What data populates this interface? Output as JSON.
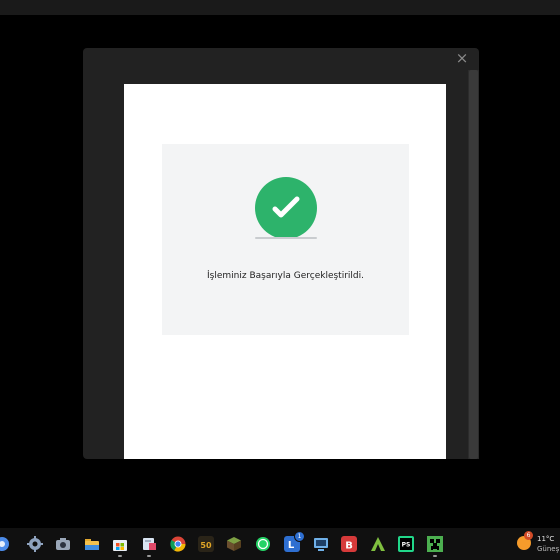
{
  "modal": {
    "close_symbol": "×",
    "success_message": "İşleminiz Başarıyla Gerçekleştirildi.",
    "success_icon": "check-circle-icon",
    "accent_color": "#2db36b"
  },
  "taskbar": {
    "icons": [
      {
        "name": "app-partial-icon",
        "color": "#4c8be8"
      },
      {
        "name": "gear-icon",
        "color": "#8fa3bf"
      },
      {
        "name": "camera-icon",
        "color": "#9aa7b8"
      },
      {
        "name": "folder-icon",
        "color": "#f2c14e"
      },
      {
        "name": "store-icon",
        "color": "#3b82f6"
      },
      {
        "name": "snipping-tool-icon",
        "color": "#d9e4f2"
      },
      {
        "name": "chrome-icon",
        "color": "#f2b705"
      },
      {
        "name": "app-50-icon",
        "color": "#e0a526"
      },
      {
        "name": "minecraft-block-icon",
        "color": "#6d8a3a"
      },
      {
        "name": "whatsapp-icon",
        "color": "#25d366"
      },
      {
        "name": "app-l-icon",
        "color": "#2e6fd1"
      },
      {
        "name": "screen-icon",
        "color": "#6fb0e8"
      },
      {
        "name": "app-b-icon",
        "color": "#d63a3a"
      },
      {
        "name": "app-a-icon",
        "color": "#7fbf3f"
      },
      {
        "name": "pycharm-icon",
        "color": "#21d789"
      },
      {
        "name": "creeper-icon",
        "color": "#4caf50"
      }
    ],
    "badge_l": "1",
    "label_50": "50",
    "label_l": "L",
    "label_b": "B",
    "label_ps": "PS",
    "weather": {
      "badge": "6",
      "temperature": "11°C",
      "description": "Güneş"
    }
  }
}
